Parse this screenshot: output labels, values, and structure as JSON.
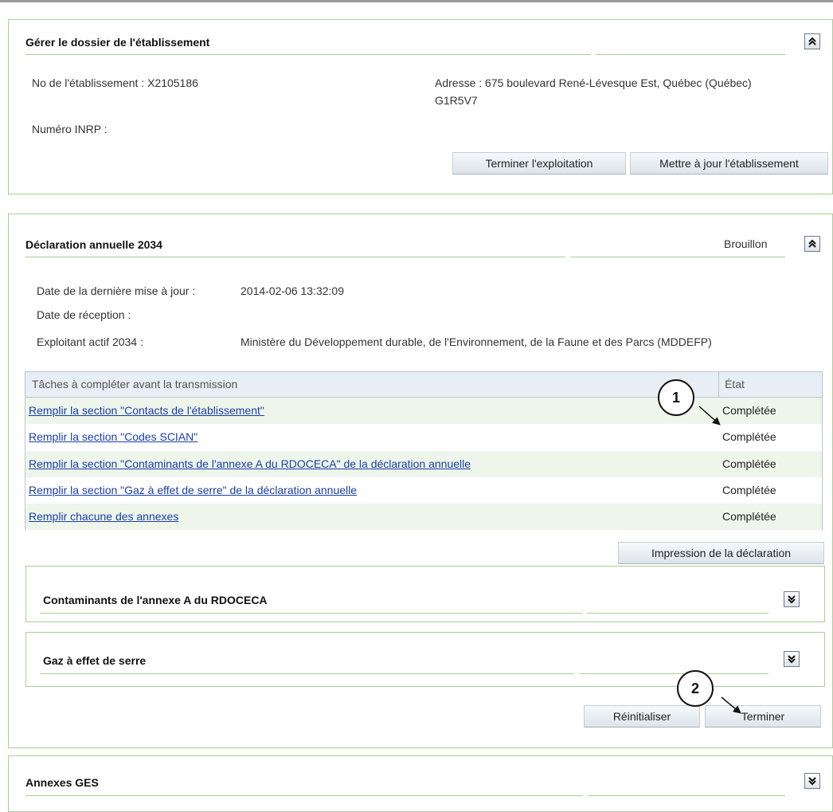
{
  "establishment_panel": {
    "title": "Gérer le dossier de l'établissement",
    "toggle_icon": "collapse-up-icon",
    "establishment_number": "No de l'établissement : X2105186",
    "address_line1": "Adresse : 675 boulevard René-Lévesque Est, Québec (Québec)",
    "address_line2": "G1R5V7",
    "inrp_number": "Numéro INRP :",
    "end_operation_label": "Terminer l'exploitation",
    "update_label": "Mettre à jour l'établissement"
  },
  "declaration_panel": {
    "title": "Déclaration annuelle 2034",
    "status": "Brouillon",
    "toggle_icon": "collapse-up-icon",
    "fields": [
      {
        "label": "Date de la dernière mise à jour :",
        "value": "2014-02-06 13:32:09"
      },
      {
        "label": "Date de réception :",
        "value": ""
      },
      {
        "label": "Exploitant actif 2034 :",
        "value": "Ministère du Développement durable, de l'Environnement, de la Faune et des Parcs (MDDEFP)"
      }
    ],
    "tasks_table": {
      "columns": [
        "Tâches à compléter avant la transmission",
        "État"
      ],
      "rows": [
        {
          "task": "Remplir la section \"Contacts de l'établissement\"",
          "state": "Complétée"
        },
        {
          "task": "Remplir la section \"Codes SCIAN\"",
          "state": "Complétée"
        },
        {
          "task": "Remplir la section \"Contaminants de l'annexe A du RDOCECA\" de la déclaration annuelle",
          "state": "Complétée"
        },
        {
          "task": "Remplir la section \"Gaz à effet de serre\" de la déclaration annuelle",
          "state": "Complétée"
        },
        {
          "task": "Remplir chacune des annexes",
          "state": "Complétée"
        }
      ]
    },
    "print_label": "Impression de la déclaration",
    "subpanels": [
      {
        "title": "Contaminants de l'annexe A du RDOCECA",
        "toggle_icon": "expand-down-icon"
      },
      {
        "title": "Gaz à effet de serre",
        "toggle_icon": "expand-down-icon"
      }
    ],
    "reset_label": "Réinitialiser",
    "finish_label": "Terminer"
  },
  "annexes_panel": {
    "title": "Annexes GES",
    "toggle_icon": "expand-down-icon"
  },
  "callouts": [
    "1",
    "2"
  ],
  "colors": {
    "panel_border": "#a9cf96",
    "link": "#1a3fa8",
    "row_alt": "#eef5ea",
    "table_header": "#e8eef6"
  }
}
